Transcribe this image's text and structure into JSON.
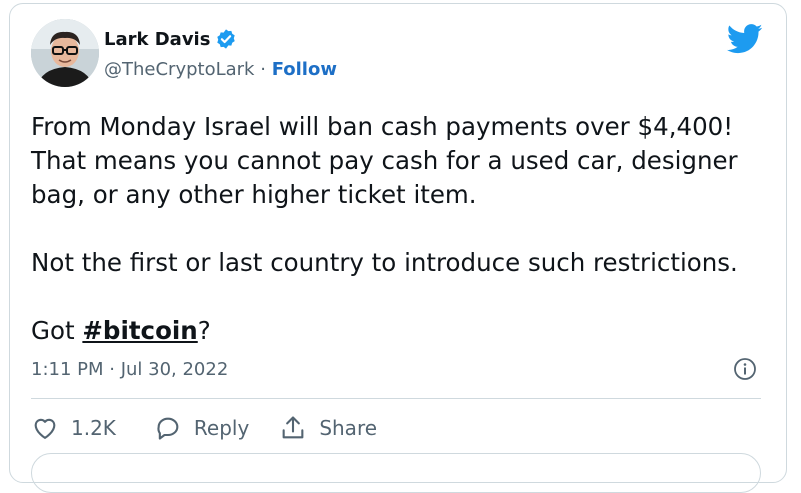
{
  "author": {
    "name": "Lark Davis",
    "handle": "@TheCryptoLark",
    "separator": "·",
    "follow_label": "Follow"
  },
  "tweet": {
    "line1": "From Monday Israel will ban cash payments over $4,400!",
    "line2": "That means you cannot pay cash for a used car, designer",
    "line3": "bag, or any other higher ticket item.",
    "line4": "Not the first or last country to introduce such restrictions.",
    "got": "Got ",
    "hashtag": "#bitcoin",
    "question": "?"
  },
  "timestamp": "1:11 PM · Jul 30, 2022",
  "actions": {
    "likes": "1.2K",
    "reply_label": "Reply",
    "share_label": "Share"
  },
  "colors": {
    "brand_blue": "#1d9bf0",
    "follow_blue": "#1d6fc6",
    "secondary_text": "#536471",
    "border": "#cfd9de"
  },
  "icons": [
    "avatar",
    "verified-badge-icon",
    "twitter-bird-icon",
    "info-icon",
    "heart-icon",
    "reply-icon",
    "share-icon"
  ]
}
